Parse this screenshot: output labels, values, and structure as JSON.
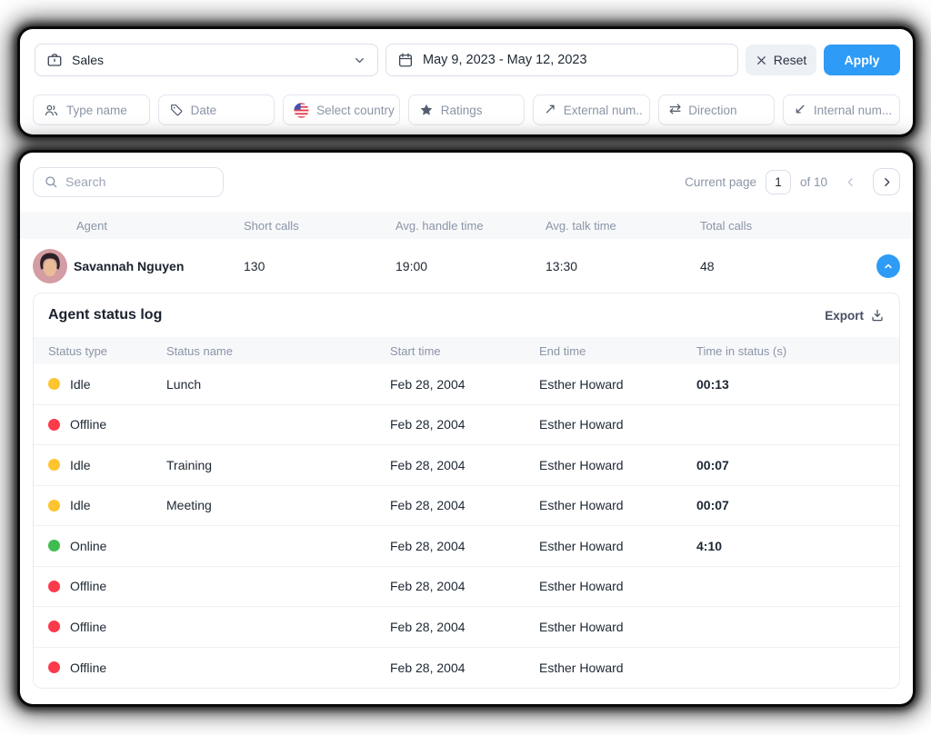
{
  "topbar": {
    "queue_select": {
      "value": "Sales"
    },
    "date_range": {
      "value": "May 9, 2023 - May 12, 2023"
    },
    "reset_label": "Reset",
    "apply_label": "Apply"
  },
  "filters": {
    "chips": [
      {
        "label": "Type name",
        "icon": "people-icon"
      },
      {
        "label": "Date",
        "icon": "tag-icon"
      },
      {
        "label": "Select country",
        "icon": "us-flag-icon"
      },
      {
        "label": "Ratings",
        "icon": "star-icon"
      },
      {
        "label": "External num..",
        "icon": "arrow-up-right-icon"
      },
      {
        "label": "Direction",
        "icon": "arrows-swap-icon"
      },
      {
        "label": "Internal num...",
        "icon": "arrow-down-left-icon"
      }
    ],
    "arrow_up_right": "↗",
    "arrows_swap": "⇄",
    "arrow_down_left": "↙"
  },
  "table_panel": {
    "search": {
      "placeholder": "Search"
    },
    "pagination": {
      "label": "Current page",
      "current": "1",
      "of_label": "of 10"
    },
    "columns": [
      "Agent",
      "Short calls",
      "Avg. handle time",
      "Avg. talk time",
      "Total calls"
    ],
    "agent_row": {
      "name": "Savannah Nguyen",
      "short_calls": "130",
      "avg_handle_time": "19:00",
      "avg_talk_time": "13:30",
      "total_calls": "48"
    }
  },
  "status_log": {
    "title": "Agent status log",
    "export_label": "Export",
    "columns": [
      "Status type",
      "Status name",
      "Start time",
      "End time",
      "Time in status (s)"
    ],
    "rows": [
      {
        "color": "yellow",
        "type": "Idle",
        "name": "Lunch",
        "start": "Feb 28, 2004",
        "end": "Esther Howard",
        "time": "00:13"
      },
      {
        "color": "red",
        "type": "Offline",
        "name": "",
        "start": "Feb 28, 2004",
        "end": "Esther Howard",
        "time": ""
      },
      {
        "color": "yellow",
        "type": "Idle",
        "name": "Training",
        "start": "Feb 28, 2004",
        "end": "Esther Howard",
        "time": "00:07"
      },
      {
        "color": "yellow",
        "type": "Idle",
        "name": "Meeting",
        "start": "Feb 28, 2004",
        "end": "Esther Howard",
        "time": "00:07"
      },
      {
        "color": "green",
        "type": "Online",
        "name": "",
        "start": "Feb 28, 2004",
        "end": "Esther Howard",
        "time": "4:10"
      },
      {
        "color": "red",
        "type": "Offline",
        "name": "",
        "start": "Feb 28, 2004",
        "end": "Esther Howard",
        "time": ""
      },
      {
        "color": "red",
        "type": "Offline",
        "name": "",
        "start": "Feb 28, 2004",
        "end": "Esther Howard",
        "time": ""
      },
      {
        "color": "red",
        "type": "Offline",
        "name": "",
        "start": "Feb 28, 2004",
        "end": "Esther Howard",
        "time": ""
      }
    ]
  },
  "colors": {
    "accent": "#2e9bf6",
    "idle": "#ffc42e",
    "offline": "#fb3b4c",
    "online": "#3fbc4f"
  }
}
